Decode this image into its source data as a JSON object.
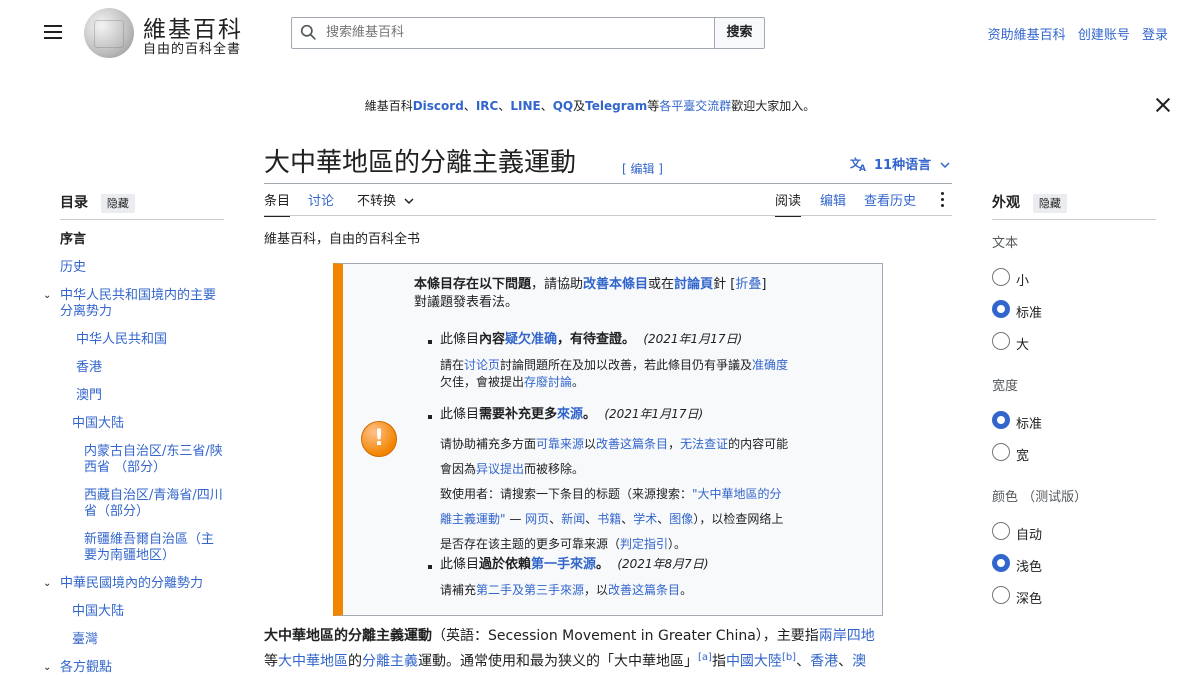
{
  "header": {
    "wordmark": "維基百科",
    "tagline": "自由的百科全書",
    "search_placeholder": "搜索維基百科",
    "search_button": "搜索",
    "user_links": [
      "资助維基百科",
      "创建账号",
      "登录"
    ]
  },
  "sitenotice": {
    "prefix": "維基百科",
    "links": [
      "Discord",
      "IRC",
      "LINE",
      "QQ",
      "Telegram"
    ],
    "seps": [
      "、",
      "、",
      "、",
      "及"
    ],
    "middle": "等",
    "link2": "各平臺交流群",
    "suffix": "歡迎大家加入。"
  },
  "page": {
    "title": "大中華地區的分離主義運動",
    "edit_label": "[ 编辑 ]",
    "languages": "11种语言",
    "tabs_left": [
      "条目",
      "讨论",
      "不转换"
    ],
    "tabs_right": [
      "阅读",
      "编辑",
      "查看历史"
    ],
    "from": "維基百科，自由的百科全书"
  },
  "toc": {
    "heading": "目录",
    "hide": "隐藏",
    "items": [
      "序言",
      "历史",
      "中华人民共和国境内的主要分离势力",
      "中华人民共和国",
      "香港",
      "澳門",
      "中国大陆",
      "内蒙古自治区/东三省/陕西省 （部分）",
      "西藏自治区/青海省/四川省（部分）",
      "新疆維吾爾自治區（主要为南疆地区）",
      "中華民國境內的分離勢力",
      "中国大陆",
      "臺灣",
      "各方觀點"
    ]
  },
  "ambox": {
    "intro_a": "本條目存在以下問題",
    "intro_b": "，請協助",
    "intro_link1": "改善本條目",
    "intro_c": "或在",
    "intro_link2": "討論頁",
    "intro_d": "針",
    "intro_fold": "折叠",
    "intro_e": "對議題發表看法。",
    "issues": [
      {
        "head_a": "此條目",
        "head_b": "內容",
        "head_link": "疑欠准确",
        "head_c": "，有待查證。",
        "date": "(2021年1月17日)",
        "line1_a": "請在",
        "line1_link1": "讨论页",
        "line1_b": "討論問題所在及加以改善，若此條目仍有爭議及",
        "line1_link2": "准确度",
        "line2_a": "欠佳，會被提出",
        "line2_link": "存廢討論",
        "line2_b": "。"
      },
      {
        "head_a": "此條目",
        "head_b": "需要补充更多",
        "head_link": "來源",
        "head_c": "。",
        "date": "(2021年1月17日)",
        "line1_a": "请协助補充多方面",
        "line1_link1": "可靠来源",
        "line1_b": "以",
        "line1_link2": "改善这篇条目",
        "line1_c": "，",
        "line1_link3": "无法查证",
        "line1_d": "的内容可能",
        "line2_a": "會因為",
        "line2_link": "异议提出",
        "line2_b": "而被移除。",
        "line3_a": "致使用者：请搜索一下条目的标题（来源搜索：",
        "line3_link": "\"大中華地區的分",
        "line4_link": "離主義運動\"",
        "line4_a": " — ",
        "line4_links": [
          "网页",
          "新闻",
          "书籍",
          "学术",
          "图像"
        ],
        "line4_b": "），以检查网络上",
        "line5_a": "是否存在该主题的更多可靠来源（",
        "line5_link": "判定指引",
        "line5_b": "）。"
      },
      {
        "head_a": "此條目",
        "head_b": "過於依賴",
        "head_link": "第一手來源",
        "head_c": "。",
        "date": "(2021年8月7日)",
        "line1_a": "请補充",
        "line1_link1": "第二手及第三手來源",
        "line1_b": "，以",
        "line1_link2": "改善这篇条目",
        "line1_c": "。"
      }
    ]
  },
  "body": {
    "bold": "大中華地區的分離主義運動",
    "l1_a": "（英語：Secession Movement in Greater China），主要指",
    "l1_link": "兩岸四地",
    "l2_a": "等",
    "l2_link1": "大中華地區",
    "l2_b": "的",
    "l2_link2": "分離主義",
    "l2_c": "運動。通常使用和最为狭义的「大中華地區」",
    "l2_ref1": "[a]",
    "l2_d": "指",
    "l2_link3": "中國大陸",
    "l2_ref2": "[b]",
    "l2_e": "、",
    "l2_link4": "香港",
    "l2_f": "、",
    "l2_link5": "澳"
  },
  "appearance": {
    "heading": "外观",
    "hide": "隐藏",
    "text_label": "文本",
    "text_options": [
      "小",
      "标准",
      "大"
    ],
    "text_selected": "标准",
    "width_label": "宽度",
    "width_options": [
      "标准",
      "宽"
    ],
    "width_selected": "标准",
    "color_label": "颜色 （测试版）",
    "color_options": [
      "自动",
      "浅色",
      "深色"
    ],
    "color_selected": "浅色"
  }
}
